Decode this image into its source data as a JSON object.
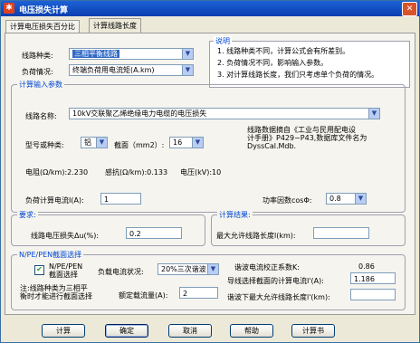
{
  "window": {
    "title": "电压损失计算",
    "icon_glyph": "✱"
  },
  "tabs": [
    {
      "label": "计算电压损失百分比",
      "active": false
    },
    {
      "label": "计算线路长度",
      "active": true
    }
  ],
  "line_type": {
    "label": "线路种类:",
    "value": "三相平衡线路"
  },
  "load_case": {
    "label": "负荷情况:",
    "value": "终端负荷用电流矩(A.km)"
  },
  "note": {
    "title": "说明",
    "lines": [
      "1. 线路种类不同，计算公式会有所差别。",
      "2. 负荷情况不同，影响输入参数。",
      "3. 对计算线路长度，我们只考虑单个负荷的情况。"
    ]
  },
  "input_group": {
    "title": "计算输入参数",
    "line_name_label": "线路名称:",
    "line_name_value": "10kV交联聚乙烯绝缘电力电缆的电压损失",
    "info_text": [
      "线路数据摘自《工业与民用配电设",
      "计手册》P429~P43,数据库文件名为",
      "DyssCal.Mdb."
    ],
    "model_label": "型号或种类:",
    "model_value": "铝",
    "section_label": "截面（mm2）:",
    "section_value": "16",
    "resistance_text": "电阻(Ω/km):2.230",
    "inductance_text": "感抗(Ω/km):0.133",
    "voltage_text": "电压(kV):10",
    "load_current_label": "负荷计算电流I(A):",
    "load_current_value": "1",
    "pf_label": "功率因数cosΦ:",
    "pf_value": "0.8"
  },
  "requirement": {
    "title": "要求:",
    "label": "线路电压损失Δu(%):",
    "value": "0.2"
  },
  "result": {
    "title": "计算结果:",
    "label": "最大允许线路长度l(km):",
    "value": ""
  },
  "neutral": {
    "title": "N/PE/PEN截面选择",
    "checkbox_label": [
      "N/PE/PEN",
      "截面选择"
    ],
    "checkbox_checked": true,
    "load_current_status_label": "负载电流状况:",
    "load_current_status_value": "20%三次谐波",
    "note_lines": [
      "注:线路种类为三相平",
      "衡时才能进行截面选择"
    ],
    "rated_current_label": "额定载流量(A):",
    "rated_current_value": "2",
    "harmonic_factor_label": "谐波电流校正系数K:",
    "harmonic_factor_value": "0.86",
    "conductor_current_label": "导线选择截面的计算电流I'(A):",
    "conductor_current_value": "1.186",
    "harmonic_length_label": "谐波下最大允许线路长度l'(km):",
    "harmonic_length_value": ""
  },
  "buttons": {
    "calc": "计算",
    "ok": "确定",
    "cancel": "取消",
    "help": "帮助",
    "calc_book": "计算书"
  },
  "colors": {
    "titlebar": "#0a3fb0",
    "group_title": "#0046d5",
    "selection": "#316ac5"
  }
}
